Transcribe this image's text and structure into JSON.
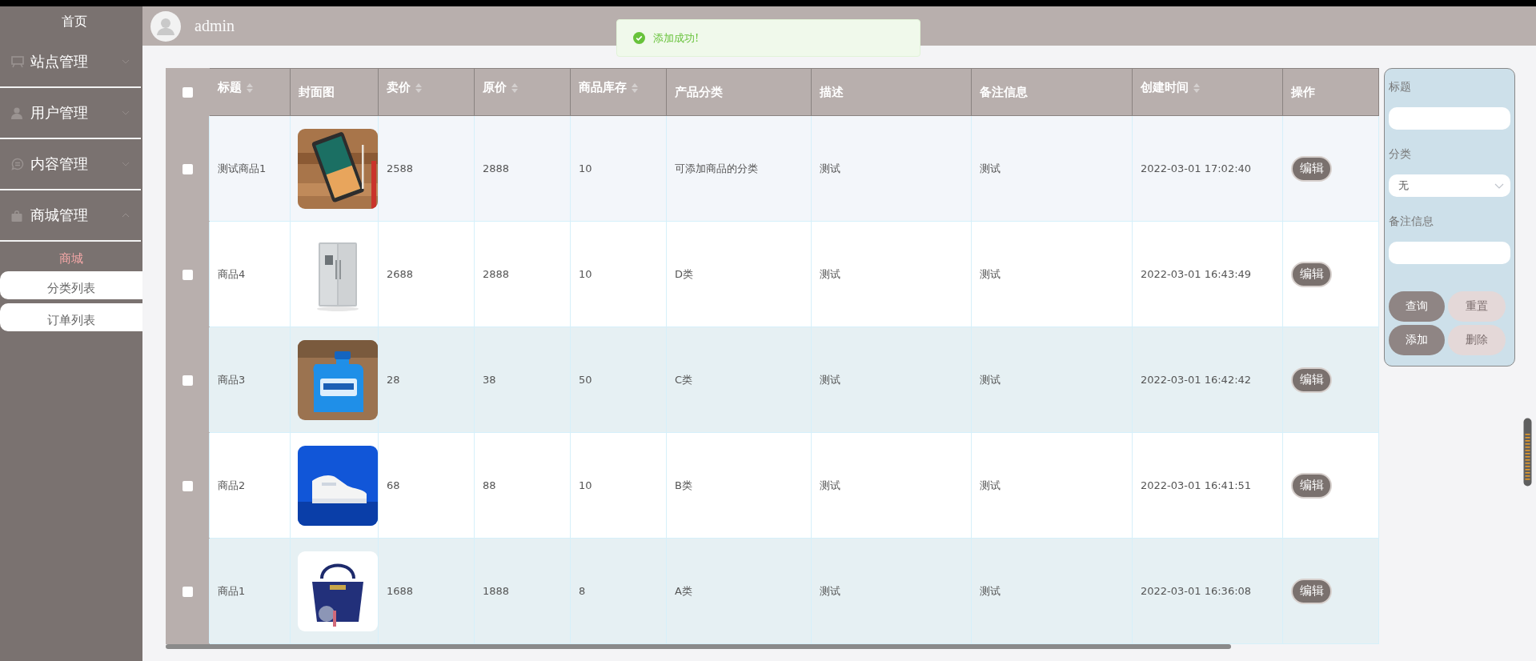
{
  "sidebar": {
    "home": "首页",
    "menus": [
      {
        "label": "站点管理",
        "expanded": false
      },
      {
        "label": "用户管理",
        "expanded": false
      },
      {
        "label": "内容管理",
        "expanded": false
      },
      {
        "label": "商城管理",
        "expanded": true,
        "group_title": "商城",
        "children": [
          {
            "label": "分类列表"
          },
          {
            "label": "订单列表"
          }
        ]
      }
    ]
  },
  "header": {
    "user": "admin"
  },
  "toast": {
    "kind": "success",
    "message": "添加成功!"
  },
  "table": {
    "select_all": {
      "checked": false
    },
    "columns": [
      {
        "label": "标题",
        "sortable": true
      },
      {
        "label": "封面图",
        "sortable": false
      },
      {
        "label": "卖价",
        "sortable": true
      },
      {
        "label": "原价",
        "sortable": true
      },
      {
        "label": "商品库存",
        "sortable": true
      },
      {
        "label": "产品分类",
        "sortable": false
      },
      {
        "label": "描述",
        "sortable": false
      },
      {
        "label": "备注信息",
        "sortable": false
      },
      {
        "label": "创建时间",
        "sortable": true
      },
      {
        "label": "操作",
        "sortable": false
      }
    ],
    "rows": [
      {
        "checked": false,
        "title": "测试商品1",
        "price": "2588",
        "original_price": "2888",
        "stock": "10",
        "category": "可添加商品的分类",
        "description": "测试",
        "note": "测试",
        "created": "2022-03-01 17:02:40",
        "action": "编辑"
      },
      {
        "checked": false,
        "title": "商品4",
        "price": "2688",
        "original_price": "2888",
        "stock": "10",
        "category": "D类",
        "description": "测试",
        "note": "测试",
        "created": "2022-03-01 16:43:49",
        "action": "编辑"
      },
      {
        "checked": false,
        "title": "商品3",
        "price": "28",
        "original_price": "38",
        "stock": "50",
        "category": "C类",
        "description": "测试",
        "note": "测试",
        "created": "2022-03-01 16:42:42",
        "action": "编辑"
      },
      {
        "checked": false,
        "title": "商品2",
        "price": "68",
        "original_price": "88",
        "stock": "10",
        "category": "B类",
        "description": "测试",
        "note": "测试",
        "created": "2022-03-01 16:41:51",
        "action": "编辑"
      },
      {
        "checked": false,
        "title": "商品1",
        "price": "1688",
        "original_price": "1888",
        "stock": "8",
        "category": "A类",
        "description": "测试",
        "note": "测试",
        "created": "2022-03-01 16:36:08",
        "action": "编辑"
      }
    ]
  },
  "filter": {
    "fields": [
      {
        "kind": "text",
        "label": "标题"
      },
      {
        "kind": "select",
        "label": "分类",
        "value": "无"
      },
      {
        "kind": "text",
        "label": "备注信息"
      }
    ],
    "buttons": [
      {
        "label": "查询",
        "kind": "dark"
      },
      {
        "label": "重置",
        "kind": "light"
      },
      {
        "label": "添加",
        "kind": "dark"
      },
      {
        "label": "删除",
        "kind": "light"
      }
    ]
  }
}
